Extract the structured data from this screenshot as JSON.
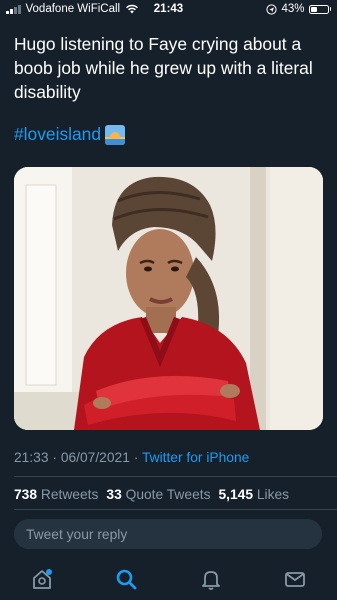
{
  "status_bar": {
    "carrier": "Vodafone WiFiCall",
    "time": "21:43",
    "battery": "43%",
    "battery_level": 0.43,
    "icons": [
      "signal-icon",
      "wifi-icon",
      "location-icon",
      "battery-icon"
    ]
  },
  "tweet": {
    "text": "Hugo listening to Faye crying about a boob job while he grew up with a literal disability",
    "hashtag": "#loveisland",
    "emoji": "sunrise-emoji",
    "photo_alt": "photo"
  },
  "meta": {
    "time": "21:33",
    "separator": "·",
    "date": "06/07/2021",
    "source": "Twitter for iPhone"
  },
  "stats": {
    "retweets_count": "738",
    "retweets_label": "Retweets",
    "quotes_count": "33",
    "quotes_label": "Quote Tweets",
    "likes_count": "5,145",
    "likes_label": "Likes"
  },
  "reply": {
    "placeholder": "Tweet your reply"
  },
  "tabbar": {
    "tabs": [
      "home-icon",
      "search-icon",
      "notifications-icon",
      "messages-icon"
    ],
    "active": "search-icon",
    "accent": "#1d9bf0",
    "inactive_color": "#8899a6"
  },
  "colors": {
    "background": "#15202b",
    "text": "#ffffff",
    "secondary": "#8899a6",
    "link": "#1d9bf0",
    "divider": "#38444d"
  }
}
